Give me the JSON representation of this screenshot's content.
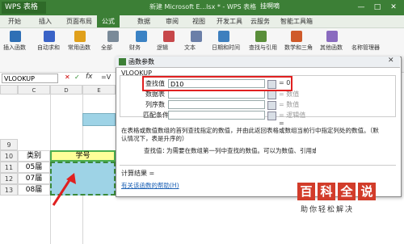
{
  "app": {
    "brand": "WPS 表格",
    "doc_title": "新建 Microsoft E...lsx * - WPS 表格",
    "user": "挂啊嘀"
  },
  "menu": {
    "tabs": [
      "开始",
      "插入",
      "页面布局",
      "公式",
      "数据",
      "审阅",
      "视图",
      "开发工具",
      "云服务",
      "智能工具箱"
    ],
    "active": "公式"
  },
  "ribbon": {
    "buttons": [
      {
        "label": "插入函数",
        "icon": "function-icon",
        "color": "#2f6fb5"
      },
      {
        "label": "自动求和",
        "icon": "sum-icon",
        "color": "#3a63c7"
      },
      {
        "label": "常用函数",
        "icon": "star-icon",
        "color": "#e0a01b"
      },
      {
        "label": "全部",
        "icon": "list-icon",
        "color": "#7a8a99"
      },
      {
        "label": "财务",
        "icon": "finance-icon",
        "color": "#3b82c4"
      },
      {
        "label": "逻辑",
        "icon": "logic-icon",
        "color": "#c7474a"
      },
      {
        "label": "文本",
        "icon": "text-icon",
        "color": "#6b7fa8"
      },
      {
        "label": "日期和时间",
        "icon": "clock-icon",
        "color": "#3e7fbe"
      },
      {
        "label": "查找与引用",
        "icon": "lookup-icon",
        "color": "#5a8e3a"
      },
      {
        "label": "数学和三角",
        "icon": "math-icon",
        "color": "#cf5a2a"
      },
      {
        "label": "其他函数",
        "icon": "more-icon",
        "color": "#8a6bbf"
      }
    ],
    "right_label": "名称管理器"
  },
  "formula_bar": {
    "name_box": "VLOOKUP",
    "fx": "fx",
    "content": "=V"
  },
  "sheet": {
    "columns": [
      "C",
      "D",
      "E"
    ],
    "rows": [
      "9",
      "10",
      "11",
      "12",
      "13"
    ],
    "header_left": "类别",
    "header_right": "学号",
    "cells": [
      "05届",
      "07届",
      "08届"
    ]
  },
  "dialog": {
    "title": "函数参数",
    "function_name": "VLOOKUP",
    "args": [
      {
        "label": "查找值",
        "value": "D10",
        "result": "= 0"
      },
      {
        "label": "数据表",
        "value": "",
        "result": "= 数值"
      },
      {
        "label": "列序数",
        "value": "",
        "result": "= 数值"
      },
      {
        "label": "匹配条件",
        "value": "",
        "result": "= 逻辑值"
      }
    ],
    "equals": "=",
    "description": "在表格或数值数组的首列查找指定的数值，并由此返回表格或数组当前行中指定列处的数值。（默认情况下，表是升序的）",
    "arg_help_label": "查找值：",
    "arg_help_text": "为需要在数组第一列中查找的数值。可以为数值、引用或文本字符串",
    "result_label": "计算结果 =",
    "help_link": "有关该函数的帮助(H)"
  },
  "watermark": {
    "brand": "百科全说",
    "slogan": "助你轻松解决",
    "chars": [
      "百",
      "科",
      "全",
      "说"
    ]
  },
  "colors": {
    "green": "#3c7f36",
    "highlight": "#e02020",
    "cell_fill": "#9ed3e6",
    "header_fill": "#ffff99"
  }
}
